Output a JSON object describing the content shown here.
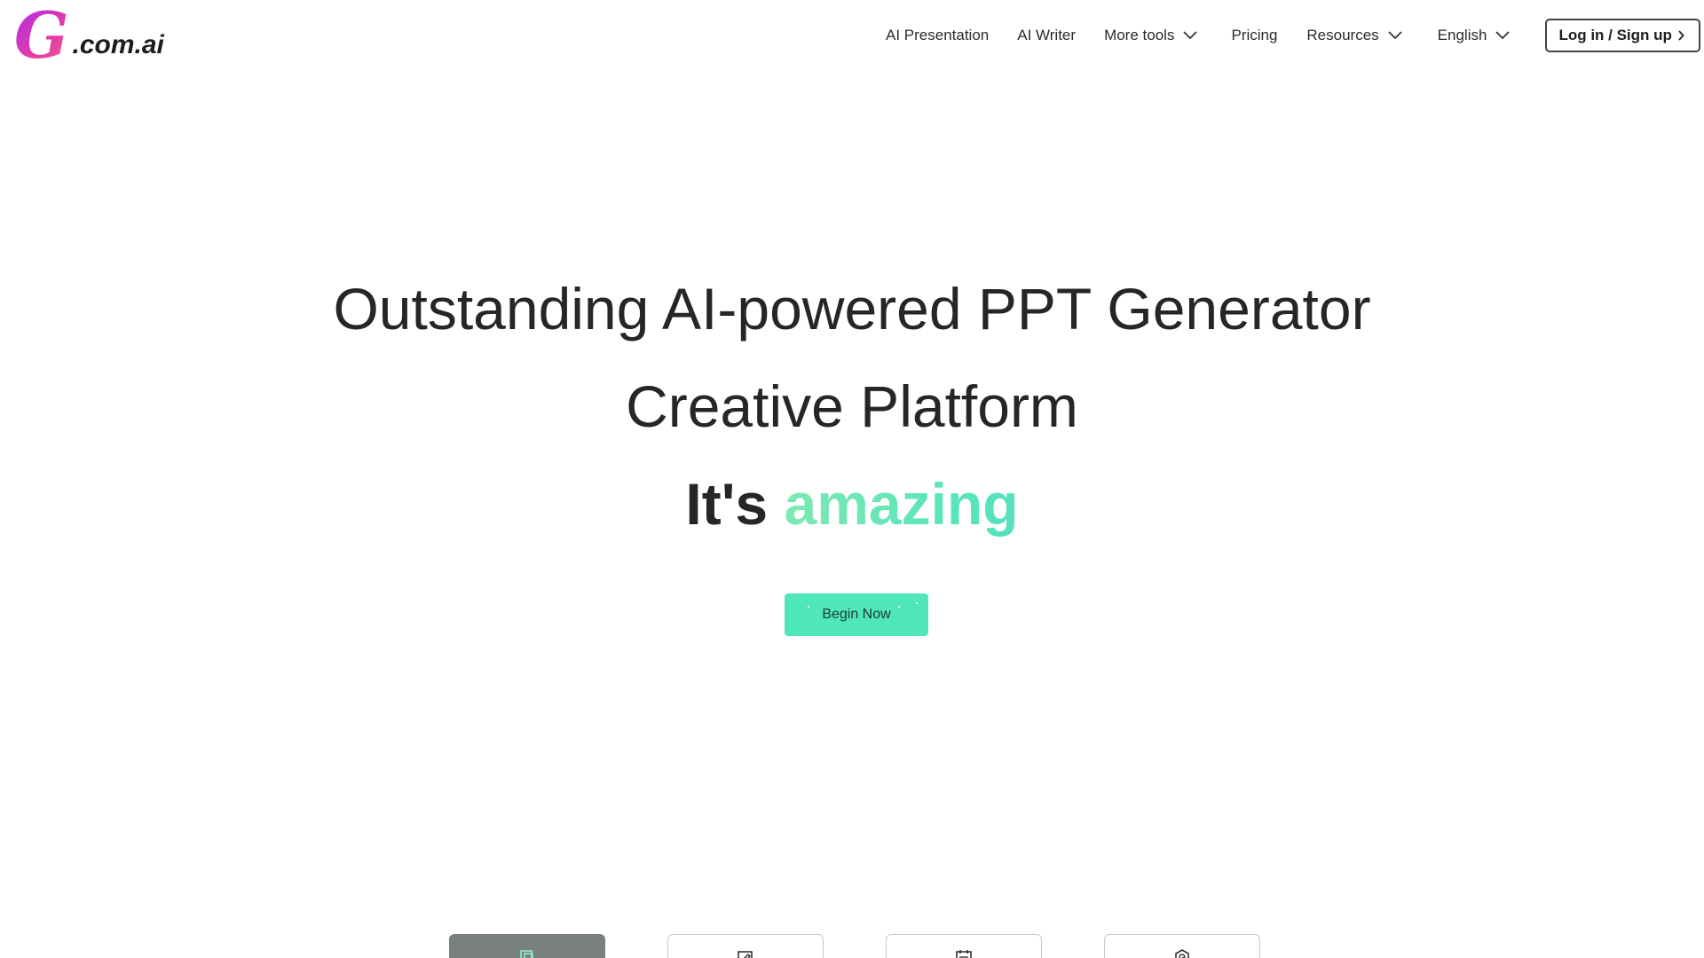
{
  "header": {
    "logo": {
      "mark": "G",
      "text": ".com.ai"
    },
    "nav": [
      {
        "label": "AI Presentation",
        "has_dropdown": false
      },
      {
        "label": "AI Writer",
        "has_dropdown": false
      },
      {
        "label": "More tools",
        "has_dropdown": true
      },
      {
        "label": "Pricing",
        "has_dropdown": false
      },
      {
        "label": "Resources",
        "has_dropdown": true
      },
      {
        "label": "English",
        "has_dropdown": true
      }
    ],
    "login_label": "Log in / Sign up"
  },
  "hero": {
    "line1": "Outstanding AI-powered PPT Generator",
    "line2": "Creative Platform",
    "line3_prefix": "It's",
    "line3_highlight": "amazing",
    "cta_label": "Begin Now"
  },
  "feature_tabs": [
    {
      "icon": "presentation-icon",
      "active": true
    },
    {
      "icon": "edit-icon",
      "active": false
    },
    {
      "icon": "calendar-icon",
      "active": false
    },
    {
      "icon": "shield-clock-icon",
      "active": false
    }
  ],
  "colors": {
    "accent": "#4fe6ba",
    "highlight_gradient_start": "#7ee8b2",
    "logo_gradient_start": "#b02fe8",
    "logo_gradient_end": "#f05e8a",
    "active_tab": "#7a807d",
    "text": "#262626"
  }
}
